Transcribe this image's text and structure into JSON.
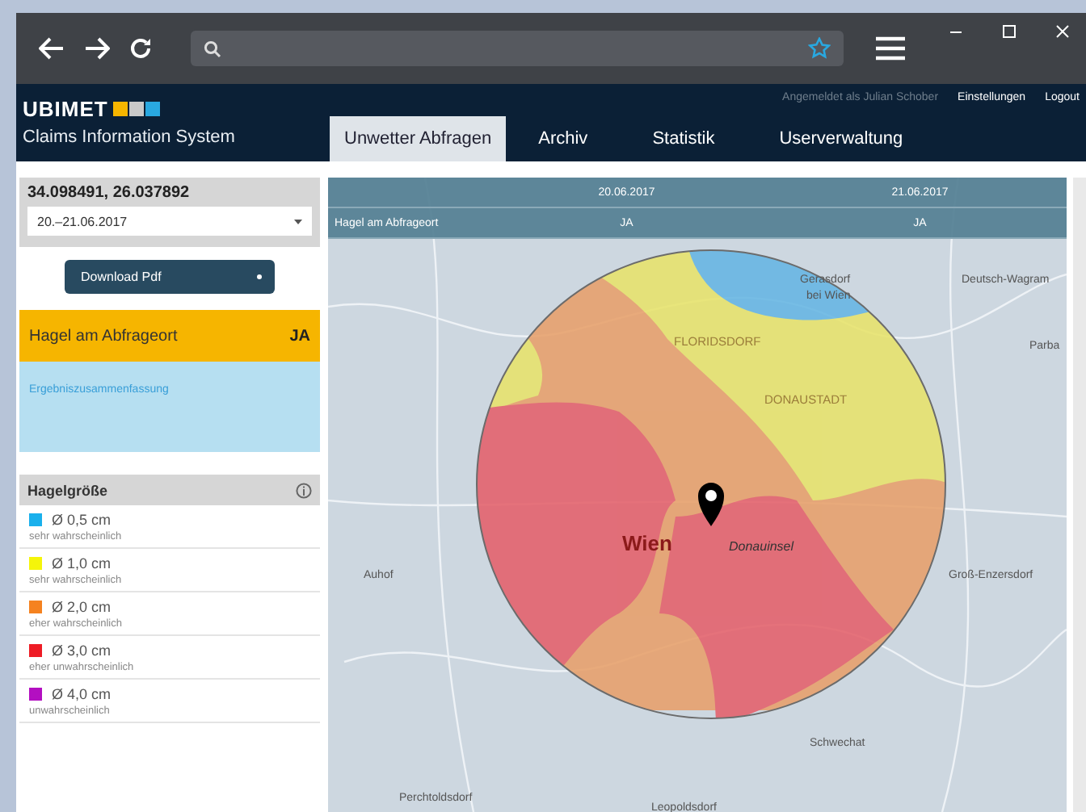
{
  "header": {
    "logo": "UBIMET",
    "subtitle": "Claims Information System",
    "user": "Angemeldet als Julian Schober",
    "links": [
      "Einstellungen",
      "Logout"
    ]
  },
  "tabs": [
    {
      "label": "Unwetter Abfragen",
      "selected": true
    },
    {
      "label": "Archiv",
      "selected": false
    },
    {
      "label": "Statistik",
      "selected": false
    },
    {
      "label": "Userverwaltung",
      "selected": false
    }
  ],
  "query": {
    "coordinates": "34.098491, 26.037892",
    "date_range": "20.–21.06.2017",
    "download": "Download Pdf"
  },
  "result": {
    "label": "Hagel am Abfrageort",
    "value": "JA",
    "summary_link": "Ergebniszusammenfassung"
  },
  "legend": {
    "title": "Hagelgröße",
    "items": [
      {
        "size": "Ø 0,5 cm",
        "probability": "sehr wahrscheinlich",
        "color": "#1ab0ec"
      },
      {
        "size": "Ø 1,0 cm",
        "probability": "sehr wahrscheinlich",
        "color": "#f5f50a"
      },
      {
        "size": "Ø 2,0 cm",
        "probability": "eher wahrscheinlich",
        "color": "#f58220"
      },
      {
        "size": "Ø 3,0 cm",
        "probability": "eher unwahrscheinlich",
        "color": "#ee1c25"
      },
      {
        "size": "Ø 4,0 cm",
        "probability": "unwahrscheinlich",
        "color": "#b30fc1"
      }
    ]
  },
  "map_table": {
    "dates": [
      "20.06.2017",
      "21.06.2017"
    ],
    "row_label": "Hagel am Abfrageort",
    "values": [
      "JA",
      "JA"
    ]
  },
  "map_labels": [
    {
      "text": "Gerasdorf",
      "kind": "town"
    },
    {
      "text": "Deutsch-Wagram",
      "kind": "town"
    },
    {
      "text": "bei Wien",
      "kind": "town"
    },
    {
      "text": "FLORIDSDORF",
      "kind": "district"
    },
    {
      "text": "Parba",
      "kind": "town"
    },
    {
      "text": "DONAUSTADT",
      "kind": "district"
    },
    {
      "text": "Wien",
      "kind": "city"
    },
    {
      "text": "Donauinsel",
      "kind": "water"
    },
    {
      "text": "Auhof",
      "kind": "town"
    },
    {
      "text": "Groß-Enzersdorf",
      "kind": "town"
    },
    {
      "text": "Schwechat",
      "kind": "town"
    },
    {
      "text": "Perchtoldsdorf",
      "kind": "town"
    },
    {
      "text": "Leopoldsdorf",
      "kind": "town"
    }
  ]
}
